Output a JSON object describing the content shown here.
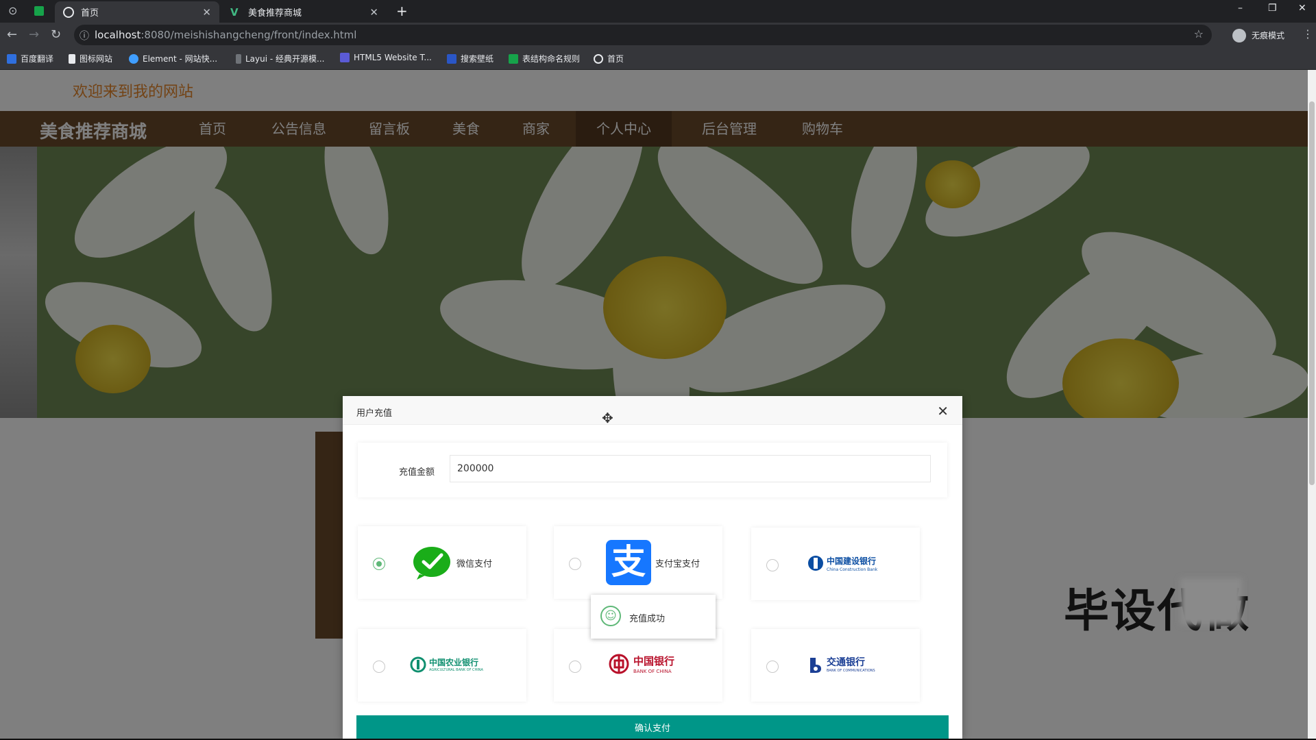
{
  "browser": {
    "tabs": [
      {
        "title": "首页",
        "active": true
      },
      {
        "title": "美食推荐商城",
        "active": false
      }
    ],
    "url_host": "localhost",
    "url_rest": ":8080/meishishangcheng/front/index.html",
    "profile_label": "无痕模式",
    "bookmarks": [
      "百度翻译",
      "图标网站",
      "Element - 网站快...",
      "Layui - 经典开源模...",
      "HTML5 Website T...",
      "搜索壁纸",
      "表结构命名规则",
      "首页"
    ]
  },
  "site": {
    "welcome": "欢迎来到我的网站",
    "brand": "美食推荐商城",
    "nav": [
      "首页",
      "公告信息",
      "留言板",
      "美食",
      "商家",
      "个人中心",
      "后台管理",
      "购物车"
    ],
    "active_nav": "个人中心"
  },
  "modal": {
    "title": "用户充值",
    "amount_label": "充值金额",
    "amount_value": "200000",
    "payments": [
      {
        "label": "微信支付",
        "checked": true
      },
      {
        "label": "支付宝支付",
        "checked": false
      },
      {
        "label": "中国建设银行",
        "checked": false
      },
      {
        "label": "中国农业银行",
        "checked": false
      },
      {
        "label": "中国银行",
        "checked": false
      },
      {
        "label": "交通银行",
        "checked": false
      }
    ],
    "bank_sublabels": {
      "ccb": "China Construction Bank",
      "abc": "AGRICULTURAL BANK OF CHINA",
      "boc": "BANK OF CHINA",
      "bocom": "BANK OF COMMUNICATIONS"
    },
    "alipay_glyph": "支",
    "toast": "充值成功",
    "confirm": "确认支付"
  },
  "watermark": "毕设代做",
  "colors": {
    "accent": "#009688",
    "nav_bg": "#6b4a2b",
    "welcome": "#e6862a",
    "wechat": "#1aad19",
    "alipay": "#1677ff",
    "ccb": "#0a4da2",
    "abc": "#0f8f6f",
    "boc": "#b8102a"
  }
}
